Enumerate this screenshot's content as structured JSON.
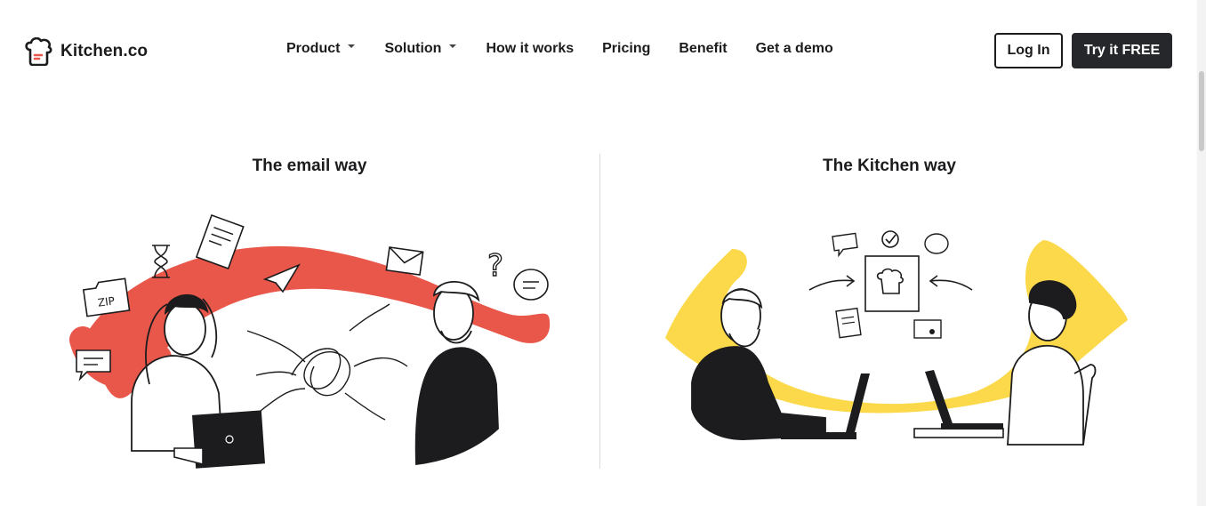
{
  "header": {
    "brand": "Kitchen.co",
    "nav": [
      {
        "label": "Product",
        "has_dropdown": true
      },
      {
        "label": "Solution",
        "has_dropdown": true
      },
      {
        "label": "How it works",
        "has_dropdown": false
      },
      {
        "label": "Pricing",
        "has_dropdown": false
      },
      {
        "label": "Benefit",
        "has_dropdown": false
      },
      {
        "label": "Get a demo",
        "has_dropdown": false
      }
    ],
    "login_label": "Log In",
    "try_label": "Try it FREE"
  },
  "comparison": {
    "left_title": "The email way",
    "right_title": "The Kitchen way",
    "zip_label": "ZIP"
  },
  "colors": {
    "text": "#1c1c1e",
    "dark_button": "#25272b",
    "email_accent": "#e8574a",
    "kitchen_accent": "#fbd94a",
    "brand_red": "#e8574a"
  },
  "icons": [
    "chef-hat-logo-icon",
    "caret-down-icon"
  ]
}
